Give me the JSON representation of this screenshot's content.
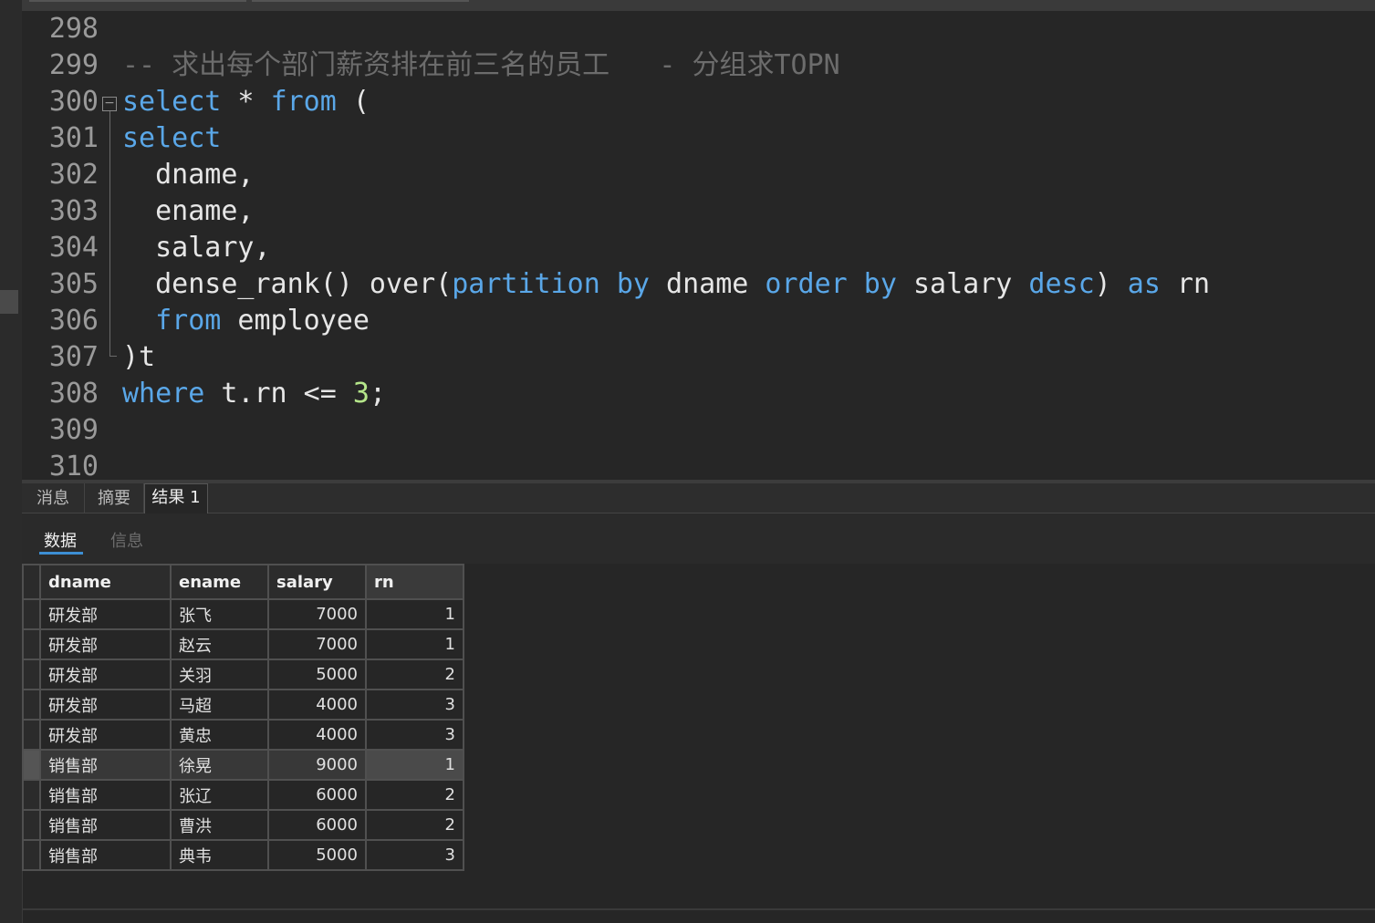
{
  "editor": {
    "lines": [
      {
        "num": "298",
        "tokens": []
      },
      {
        "num": "299",
        "tokens": [
          {
            "t": "-- 求出每个部门薪资排在前三名的员工   - 分组求TOPN",
            "c": "cm"
          }
        ]
      },
      {
        "num": "300",
        "tokens": [
          {
            "t": "select",
            "c": "kw"
          },
          {
            "t": " * ",
            "c": ""
          },
          {
            "t": "from",
            "c": "kw"
          },
          {
            "t": " (",
            "c": ""
          }
        ]
      },
      {
        "num": "301",
        "tokens": [
          {
            "t": "select",
            "c": "kw"
          }
        ]
      },
      {
        "num": "302",
        "tokens": [
          {
            "t": "  dname,",
            "c": ""
          }
        ]
      },
      {
        "num": "303",
        "tokens": [
          {
            "t": "  ename,",
            "c": ""
          }
        ]
      },
      {
        "num": "304",
        "tokens": [
          {
            "t": "  salary,",
            "c": ""
          }
        ]
      },
      {
        "num": "305",
        "tokens": [
          {
            "t": "  dense_rank() over(",
            "c": ""
          },
          {
            "t": "partition",
            "c": "kw"
          },
          {
            "t": " ",
            "c": ""
          },
          {
            "t": "by",
            "c": "kw"
          },
          {
            "t": " dname ",
            "c": ""
          },
          {
            "t": "order",
            "c": "kw"
          },
          {
            "t": " ",
            "c": ""
          },
          {
            "t": "by",
            "c": "kw"
          },
          {
            "t": " salary ",
            "c": ""
          },
          {
            "t": "desc",
            "c": "kw"
          },
          {
            "t": ") ",
            "c": ""
          },
          {
            "t": "as",
            "c": "kw"
          },
          {
            "t": " rn",
            "c": ""
          }
        ]
      },
      {
        "num": "306",
        "tokens": [
          {
            "t": "  ",
            "c": ""
          },
          {
            "t": "from",
            "c": "kw"
          },
          {
            "t": " employee",
            "c": ""
          }
        ]
      },
      {
        "num": "307",
        "tokens": [
          {
            "t": ")t",
            "c": ""
          }
        ]
      },
      {
        "num": "308",
        "tokens": [
          {
            "t": "where",
            "c": "kw"
          },
          {
            "t": " t.rn <= ",
            "c": ""
          },
          {
            "t": "3",
            "c": "num"
          },
          {
            "t": ";",
            "c": ""
          }
        ]
      },
      {
        "num": "309",
        "tokens": []
      },
      {
        "num": "310",
        "tokens": []
      }
    ]
  },
  "result_tabs": [
    "消息",
    "摘要",
    "结果 1"
  ],
  "sub_tabs": {
    "data": "数据",
    "info": "信息"
  },
  "grid": {
    "columns": [
      "dname",
      "ename",
      "salary",
      "rn"
    ],
    "rows": [
      [
        "研发部",
        "张飞",
        "7000",
        "1"
      ],
      [
        "研发部",
        "赵云",
        "7000",
        "1"
      ],
      [
        "研发部",
        "关羽",
        "5000",
        "2"
      ],
      [
        "研发部",
        "马超",
        "4000",
        "3"
      ],
      [
        "研发部",
        "黄忠",
        "4000",
        "3"
      ],
      [
        "销售部",
        "徐晃",
        "9000",
        "1"
      ],
      [
        "销售部",
        "张辽",
        "6000",
        "2"
      ],
      [
        "销售部",
        "曹洪",
        "6000",
        "2"
      ],
      [
        "销售部",
        "典韦",
        "5000",
        "3"
      ]
    ],
    "selected_row": 5
  }
}
